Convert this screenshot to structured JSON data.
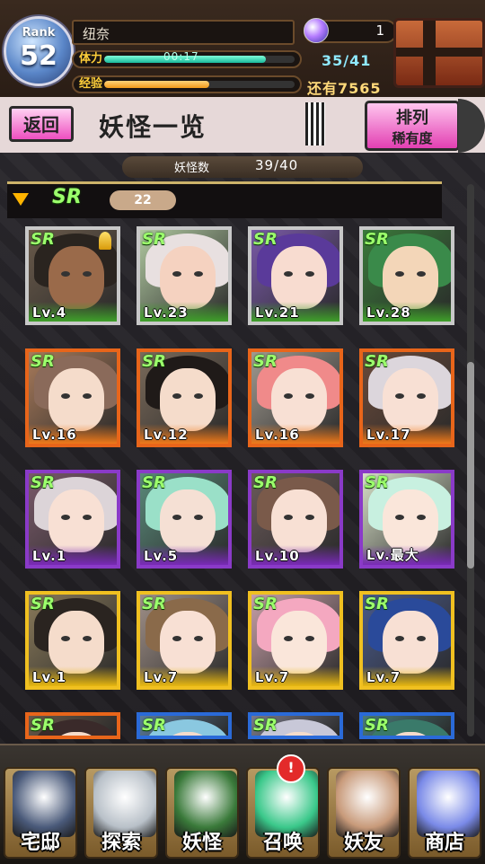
{
  "player": {
    "rank_label": "Rank",
    "rank": "52",
    "name": "纽奈",
    "gems": "1",
    "stamina_label": "体力",
    "stamina_timer": "00:17",
    "stamina": "35/41",
    "stamina_fraction": 0.85,
    "exp_label": "经验",
    "exp_remaining": "还有7565",
    "exp_fraction": 0.55
  },
  "header": {
    "back_label": "返回",
    "title": "妖怪一览",
    "sort_label": "排列",
    "sort_value": "稀有度"
  },
  "inventory": {
    "count_label": "妖怪数",
    "count_value": "39/40"
  },
  "section": {
    "rarity": "SR",
    "count": "22"
  },
  "cards": [
    {
      "rarity": "SR",
      "level": "Lv.4",
      "frame": "#c8c8c8",
      "band": "#3fa02a",
      "bg": "#6a5a4a",
      "hair": "#2a241f",
      "skin": "#9a6a4a"
    },
    {
      "rarity": "SR",
      "level": "Lv.23",
      "frame": "#c8c8c8",
      "band": "#3fa02a",
      "bg": "#b0c8a0",
      "hair": "#e8e0e0",
      "skin": "#f5d2c0"
    },
    {
      "rarity": "SR",
      "level": "Lv.21",
      "frame": "#c8c8c8",
      "band": "#3fa02a",
      "bg": "#7a5aa8",
      "hair": "#5a3a9a",
      "skin": "#f8dcd0"
    },
    {
      "rarity": "SR",
      "level": "Lv.28",
      "frame": "#c8c8c8",
      "band": "#3fa02a",
      "bg": "#3a7a3a",
      "hair": "#3a8a4a",
      "skin": "#f3d6b8"
    },
    {
      "rarity": "SR",
      "level": "Lv.16",
      "frame": "#e8651a",
      "band": "#f07a1a",
      "bg": "#a87a5a",
      "hair": "#8a6a5a",
      "skin": "#f5dccb"
    },
    {
      "rarity": "SR",
      "level": "Lv.12",
      "frame": "#e8651a",
      "band": "#f07a1a",
      "bg": "#7a6a5a",
      "hair": "#1f1a18",
      "skin": "#f5dccb"
    },
    {
      "rarity": "SR",
      "level": "Lv.16",
      "frame": "#e8651a",
      "band": "#f07a1a",
      "bg": "#a09a90",
      "hair": "#f08a8a",
      "skin": "#f8e0d4"
    },
    {
      "rarity": "SR",
      "level": "Lv.17",
      "frame": "#e8651a",
      "band": "#f07a1a",
      "bg": "#6a4a3a",
      "hair": "#dcd6dc",
      "skin": "#f8e0d4"
    },
    {
      "rarity": "SR",
      "level": "Lv.1",
      "frame": "#8a3ac8",
      "band": "#7a2ab8",
      "bg": "#7a5a6a",
      "hair": "#dcd4d8",
      "skin": "#f8e0d4"
    },
    {
      "rarity": "SR",
      "level": "Lv.5",
      "frame": "#8a3ac8",
      "band": "#7a2ab8",
      "bg": "#5a8a7a",
      "hair": "#9ae0c8",
      "skin": "#f5e0d4"
    },
    {
      "rarity": "SR",
      "level": "Lv.10",
      "frame": "#8a3ac8",
      "band": "#7a2ab8",
      "bg": "#6a5a5a",
      "hair": "#7a5a4a",
      "skin": "#f8e0d4"
    },
    {
      "rarity": "SR",
      "level": "Lv.最大",
      "frame": "#8a3ac8",
      "band": "#7a2ab8",
      "bg": "#d8e0c8",
      "hair": "#c8f0e0",
      "skin": "#fae6da"
    },
    {
      "rarity": "SR",
      "level": "Lv.1",
      "frame": "#f0c020",
      "band": "#e8b810",
      "bg": "#8a7a5a",
      "hair": "#2a2420",
      "skin": "#f5dccb"
    },
    {
      "rarity": "SR",
      "level": "Lv.7",
      "frame": "#f0c020",
      "band": "#e8b810",
      "bg": "#a09088",
      "hair": "#8a6a4a",
      "skin": "#f8e0d4"
    },
    {
      "rarity": "SR",
      "level": "Lv.7",
      "frame": "#f0c020",
      "band": "#e8b810",
      "bg": "#c8a0a8",
      "hair": "#f4a8c0",
      "skin": "#fae6da"
    },
    {
      "rarity": "SR",
      "level": "Lv.7",
      "frame": "#f0c020",
      "band": "#e8b810",
      "bg": "#4a5a8a",
      "hair": "#2a4a9a",
      "skin": "#f8e0d4"
    },
    {
      "rarity": "SR",
      "level": "",
      "frame": "#e8651a",
      "band": "#e8651a",
      "bg": "#6a5a4a",
      "hair": "#3a2a2a",
      "skin": "#f5dccb"
    },
    {
      "rarity": "SR",
      "level": "",
      "frame": "#2a6ad8",
      "band": "#2a6ad8",
      "bg": "#5a7a9a",
      "hair": "#8ac8e0",
      "skin": "#f5dccb"
    },
    {
      "rarity": "SR",
      "level": "",
      "frame": "#2a6ad8",
      "band": "#2a6ad8",
      "bg": "#7a7a8a",
      "hair": "#c8c8d8",
      "skin": "#f5dccb"
    },
    {
      "rarity": "SR",
      "level": "",
      "frame": "#2a6ad8",
      "band": "#2a6ad8",
      "bg": "#4a7a7a",
      "hair": "#3a7a6a",
      "skin": "#f5dccb"
    }
  ],
  "nav": [
    {
      "label": "宅邸",
      "icon": "house-icon",
      "art": "#4a5a7a",
      "name": "nav-house"
    },
    {
      "label": "探索",
      "icon": "magnifier-icon",
      "art": "#b8c0c8",
      "name": "nav-explore"
    },
    {
      "label": "妖怪",
      "icon": "scroll-icon",
      "art": "#3a7a3a",
      "name": "nav-yokai"
    },
    {
      "label": "召唤",
      "icon": "pentagram-icon",
      "art": "#3ac88a",
      "name": "nav-summon",
      "badge": "!"
    },
    {
      "label": "妖友",
      "icon": "friend-icon",
      "art": "#c89a7a",
      "name": "nav-friends"
    },
    {
      "label": "商店",
      "icon": "orb-icon",
      "art": "#7a8ae8",
      "name": "nav-shop"
    }
  ]
}
